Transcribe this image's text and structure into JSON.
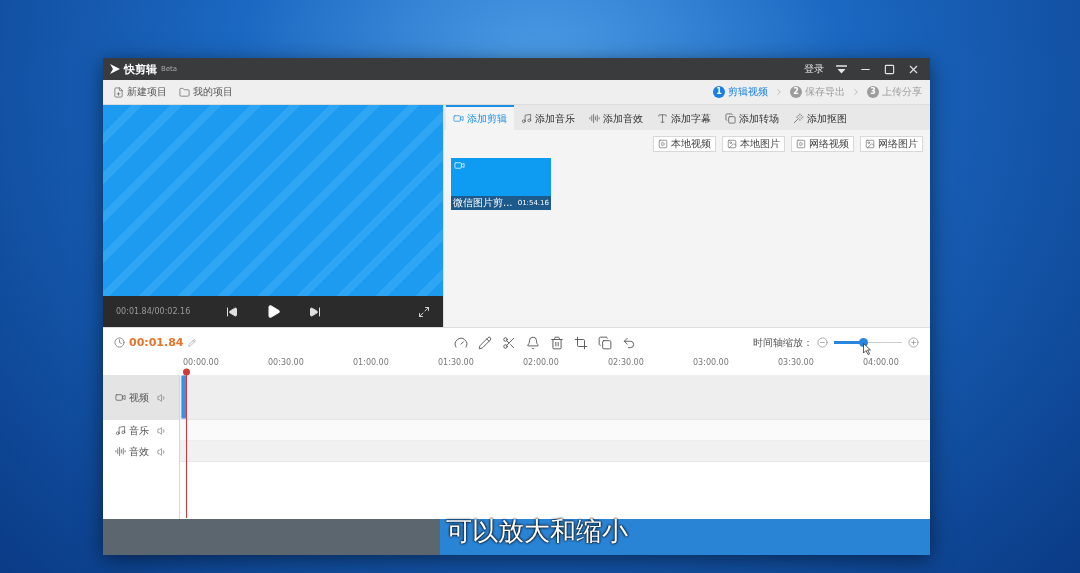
{
  "window": {
    "title": "快剪辑",
    "badge": "Beta",
    "login": "登录"
  },
  "toolbar": {
    "items": [
      "新建项目",
      "我的项目"
    ],
    "steps": [
      {
        "number": "1",
        "label": "剪辑视频",
        "selected": true
      },
      {
        "number": "2",
        "label": "保存导出",
        "selected": false
      },
      {
        "number": "3",
        "label": "上传分享",
        "selected": false
      }
    ]
  },
  "preview": {
    "time": "00:01.84/00:02.16"
  },
  "tabs": [
    {
      "label": "添加剪辑",
      "selected": true
    },
    {
      "label": "添加音乐",
      "selected": false
    },
    {
      "label": "添加音效",
      "selected": false
    },
    {
      "label": "添加字幕",
      "selected": false
    },
    {
      "label": "添加转场",
      "selected": false
    },
    {
      "label": "添加抠图",
      "selected": false
    }
  ],
  "import_buttons": [
    "本地视频",
    "本地图片",
    "网络视频",
    "网络图片"
  ],
  "clips": [
    {
      "name": "微信图片剪...",
      "duration": "01:54.16"
    }
  ],
  "timeline": {
    "current_time": "00:01.84",
    "zoom_label": "时间轴缩放：",
    "zoom": {
      "level": 0.44
    },
    "ruler": [
      "00:00.00",
      "00:30.00",
      "01:00.00",
      "01:30.00",
      "02:00.00",
      "02:30.00",
      "03:00.00",
      "03:30.00",
      "04:00.00"
    ],
    "tracks": [
      {
        "kind": "video",
        "label": "视频",
        "selected": true
      },
      {
        "kind": "music",
        "label": "音乐",
        "selected": false
      },
      {
        "kind": "sound_effect",
        "label": "音效",
        "selected": false
      }
    ]
  },
  "caption": "可以放大和缩小"
}
